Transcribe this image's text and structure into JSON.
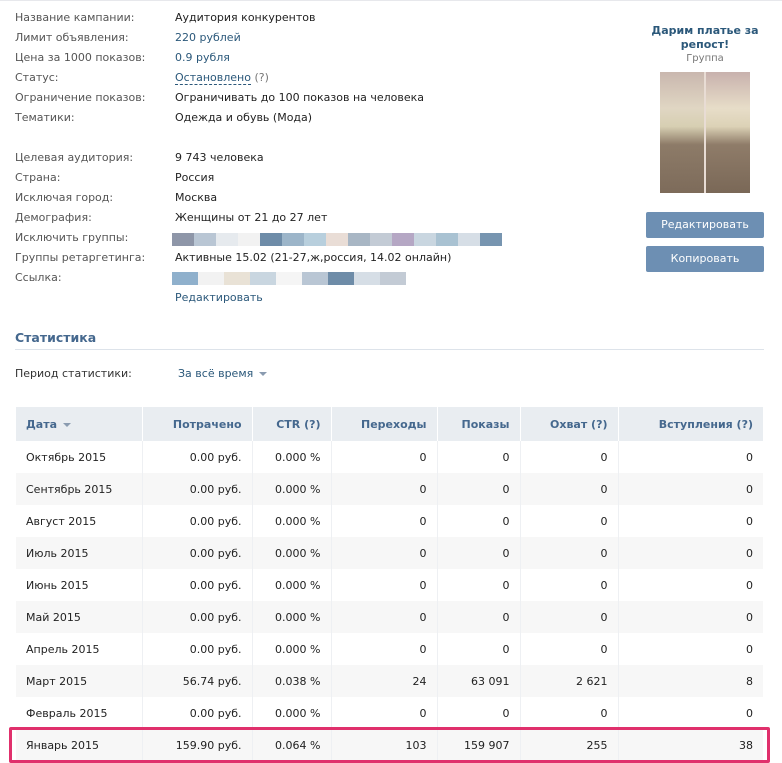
{
  "campaign": {
    "rows": [
      {
        "label": "Название кампании:",
        "value": "Аудитория конкурентов"
      },
      {
        "label": "Лимит объявления:",
        "value": "220 рублей"
      },
      {
        "label": "Цена за 1000 показов:",
        "value": "0.9 рубля"
      },
      {
        "label": "Статус:",
        "value": "Остановлено",
        "hint": "(?)"
      },
      {
        "label": "Ограничение показов:",
        "value": "Ограничивать до 100 показов на человека"
      },
      {
        "label": "Тематики:",
        "value": "Одежда и обувь (Мода)"
      },
      {
        "label": "Целевая аудитория:",
        "value": "9 743 человека"
      },
      {
        "label": "Страна:",
        "value": "Россия"
      },
      {
        "label": "Исключая город:",
        "value": "Москва"
      },
      {
        "label": "Демография:",
        "value": "Женщины от 21 до 27 лет"
      },
      {
        "label": "Исключить группы:",
        "value": ""
      },
      {
        "label": "Группы ретаргетинга:",
        "value": "Активные 15.02 (21-27,ж,россия, 14.02 онлайн)"
      },
      {
        "label": "Ссылка:",
        "value": ""
      }
    ],
    "edit_link": "Редактировать",
    "blurred_colors": [
      "#8e96a8",
      "#b9c6d4",
      "#e6eaee",
      "#f2f2f2",
      "#6e8ca8",
      "#9cb5c9",
      "#b8cfdd",
      "#e9ddd6",
      "#a8b6c4",
      "#c3cbd5",
      "#b5a7c4",
      "#c9d6e0",
      "#a9c2d2",
      "#d6dee6",
      "#7795b0"
    ],
    "link_colors": [
      "#8fb0cc",
      "#f2f2f2",
      "#e9e2d6",
      "#c9d6e0",
      "#f5f5f5",
      "#b9c6d4",
      "#6e8ca8",
      "#d6dee6",
      "#c3cbd5"
    ]
  },
  "ad": {
    "title": "Дарим платье за репост!",
    "subtitle": "Группа",
    "edit_button": "Редактировать",
    "copy_button": "Копировать"
  },
  "stats": {
    "title": "Статистика",
    "period_label": "Период статистики:",
    "period_value": "За всё время",
    "headers": [
      "Дата",
      "Потрачено",
      "CTR (?)",
      "Переходы",
      "Показы",
      "Охват (?)",
      "Вступления (?)"
    ],
    "rows": [
      [
        "Октябрь 2015",
        "0.00 руб.",
        "0.000 %",
        "0",
        "0",
        "0",
        "0"
      ],
      [
        "Сентябрь 2015",
        "0.00 руб.",
        "0.000 %",
        "0",
        "0",
        "0",
        "0"
      ],
      [
        "Август 2015",
        "0.00 руб.",
        "0.000 %",
        "0",
        "0",
        "0",
        "0"
      ],
      [
        "Июль 2015",
        "0.00 руб.",
        "0.000 %",
        "0",
        "0",
        "0",
        "0"
      ],
      [
        "Июнь 2015",
        "0.00 руб.",
        "0.000 %",
        "0",
        "0",
        "0",
        "0"
      ],
      [
        "Май 2015",
        "0.00 руб.",
        "0.000 %",
        "0",
        "0",
        "0",
        "0"
      ],
      [
        "Апрель 2015",
        "0.00 руб.",
        "0.000 %",
        "0",
        "0",
        "0",
        "0"
      ],
      [
        "Март 2015",
        "56.74 руб.",
        "0.038 %",
        "24",
        "63 091",
        "2 621",
        "8"
      ],
      [
        "Февраль 2015",
        "0.00 руб.",
        "0.000 %",
        "0",
        "0",
        "0",
        "0"
      ],
      [
        "Январь 2015",
        "159.90 руб.",
        "0.064 %",
        "103",
        "159 907",
        "255",
        "38"
      ]
    ],
    "highlight_color": "#e0306c"
  }
}
